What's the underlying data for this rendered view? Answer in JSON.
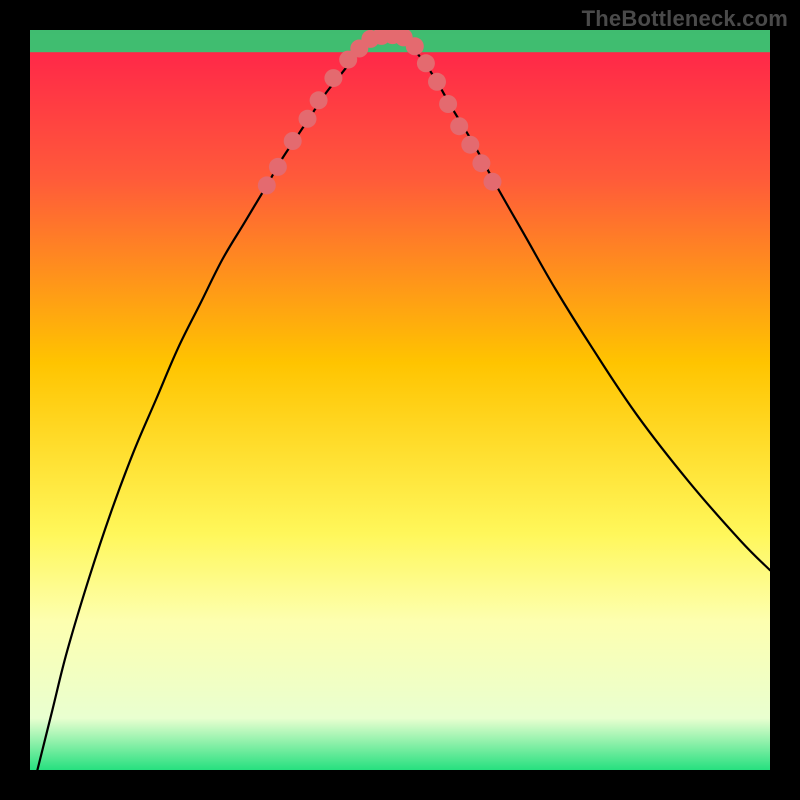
{
  "watermark": "TheBottleneck.com",
  "chart_data": {
    "type": "line",
    "title": "",
    "xlabel": "",
    "ylabel": "",
    "xlim": [
      0,
      100
    ],
    "ylim": [
      0,
      100
    ],
    "background_gradient": {
      "stops": [
        {
          "pos": 0.0,
          "color": "#ff1f4b"
        },
        {
          "pos": 0.2,
          "color": "#ff5a3a"
        },
        {
          "pos": 0.45,
          "color": "#ffc400"
        },
        {
          "pos": 0.68,
          "color": "#fff75a"
        },
        {
          "pos": 0.8,
          "color": "#fdffb0"
        },
        {
          "pos": 0.93,
          "color": "#e9ffd0"
        },
        {
          "pos": 1.0,
          "color": "#26e07f"
        }
      ]
    },
    "green_band": {
      "y_from": 97,
      "y_to": 100,
      "color": "#1fd877"
    },
    "series": [
      {
        "name": "curve",
        "color": "#000000",
        "stroke_width": 2.2,
        "x": [
          1,
          3,
          5,
          8,
          11,
          14,
          17,
          20,
          23,
          26,
          29,
          32,
          34,
          36,
          38,
          40,
          42,
          44,
          45.5,
          47,
          49,
          51,
          53,
          55,
          57,
          60,
          63,
          67,
          71,
          76,
          82,
          89,
          96,
          100
        ],
        "y": [
          0,
          8,
          16,
          26,
          35,
          43,
          50,
          57,
          63,
          69,
          74,
          79,
          82.5,
          85.5,
          88.5,
          91.5,
          94,
          96.5,
          98.2,
          99.2,
          99.2,
          98.2,
          96,
          93,
          89.5,
          84.5,
          79,
          72,
          65,
          57,
          48,
          39,
          31,
          27
        ]
      }
    ],
    "markers": {
      "color": "#e46a6f",
      "radius": 9,
      "points": [
        {
          "x": 32.0,
          "y": 79.0
        },
        {
          "x": 33.5,
          "y": 81.5
        },
        {
          "x": 35.5,
          "y": 85.0
        },
        {
          "x": 37.5,
          "y": 88.0
        },
        {
          "x": 39.0,
          "y": 90.5
        },
        {
          "x": 41.0,
          "y": 93.5
        },
        {
          "x": 43.0,
          "y": 96.0
        },
        {
          "x": 44.5,
          "y": 97.5
        },
        {
          "x": 46.0,
          "y": 98.8
        },
        {
          "x": 47.5,
          "y": 99.2
        },
        {
          "x": 49.0,
          "y": 99.3
        },
        {
          "x": 50.5,
          "y": 99.0
        },
        {
          "x": 52.0,
          "y": 97.8
        },
        {
          "x": 53.5,
          "y": 95.5
        },
        {
          "x": 55.0,
          "y": 93.0
        },
        {
          "x": 56.5,
          "y": 90.0
        },
        {
          "x": 58.0,
          "y": 87.0
        },
        {
          "x": 59.5,
          "y": 84.5
        },
        {
          "x": 61.0,
          "y": 82.0
        },
        {
          "x": 62.5,
          "y": 79.5
        }
      ]
    }
  }
}
